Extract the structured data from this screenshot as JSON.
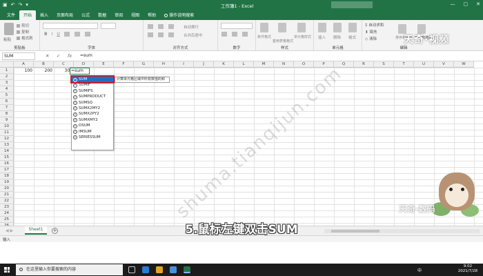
{
  "titlebar": {
    "title": "工作簿1 - Excel",
    "window_controls": [
      "—",
      "▢",
      "✕"
    ]
  },
  "menu": {
    "tabs": [
      "文件",
      "开始",
      "插入",
      "页面布局",
      "公式",
      "数据",
      "审阅",
      "视图",
      "帮助",
      "操作说明搜索"
    ],
    "active": "开始"
  },
  "ribbon": {
    "clipboard": {
      "paste": "粘贴",
      "cut": "剪切",
      "copy": "复制",
      "format_painter": "格式刷",
      "label": "剪贴板"
    },
    "font": {
      "bold": "B",
      "italic": "I",
      "underline": "U",
      "label": "字体"
    },
    "alignment": {
      "wrap": "自动换行",
      "merge": "合并后居中",
      "label": "对齐方式"
    },
    "number": {
      "label": "数字"
    },
    "styles": {
      "conditional": "条件格式",
      "table": "套用表格格式",
      "cell": "单元格样式",
      "label": "样式"
    },
    "cells": {
      "insert": "插入",
      "delete": "删除",
      "format": "格式",
      "label": "单元格"
    },
    "editing": {
      "autosum": "自动求和",
      "fill": "填充",
      "clear": "清除",
      "sort": "排序和筛选",
      "find": "查找和选择",
      "label": "编辑"
    }
  },
  "watermarks": {
    "top": "天奇·视频",
    "bottom": "天奇·数码",
    "diagonal": "shuma.tianqijun.com"
  },
  "formula_bar": {
    "name_box": "SUM",
    "cancel": "✕",
    "enter": "✓",
    "fx": "fx",
    "formula": "=sum"
  },
  "grid": {
    "columns": [
      "A",
      "B",
      "C",
      "D",
      "E",
      "F",
      "G",
      "H",
      "I",
      "J",
      "K",
      "L",
      "M",
      "N",
      "O",
      "P",
      "Q",
      "R",
      "S",
      "T",
      "U",
      "V",
      "W"
    ],
    "rows": [
      "1",
      "2",
      "3",
      "4",
      "5",
      "6",
      "7",
      "8",
      "9",
      "10",
      "11",
      "12",
      "13",
      "14",
      "15",
      "16",
      "17",
      "18",
      "19",
      "20",
      "21",
      "22",
      "23",
      "24",
      "25",
      "26"
    ],
    "cells": {
      "A1": "100",
      "B1": "200",
      "C1": "300",
      "D1": "=sum"
    }
  },
  "autocomplete": {
    "items": [
      "SUM",
      "SUMIF",
      "SUMIFS",
      "SUMPRODUCT",
      "SUMSQ",
      "SUMX2MY2",
      "SUMX2PY2",
      "SUMXMY2",
      "DSUM",
      "IMSUM",
      "SERIESSUM"
    ],
    "selected": "SUM",
    "tooltip": "计算单元格区域中所有数值的和"
  },
  "sheets": {
    "tabs": [
      "Sheet1"
    ],
    "add": "+"
  },
  "status": {
    "mode": "输入"
  },
  "caption": "5.鼠标左键双击SUM",
  "taskbar": {
    "search_placeholder": "在这里输入你要搜索的内容",
    "time": "9:02",
    "date": "2021/7/28",
    "ime": "中"
  }
}
